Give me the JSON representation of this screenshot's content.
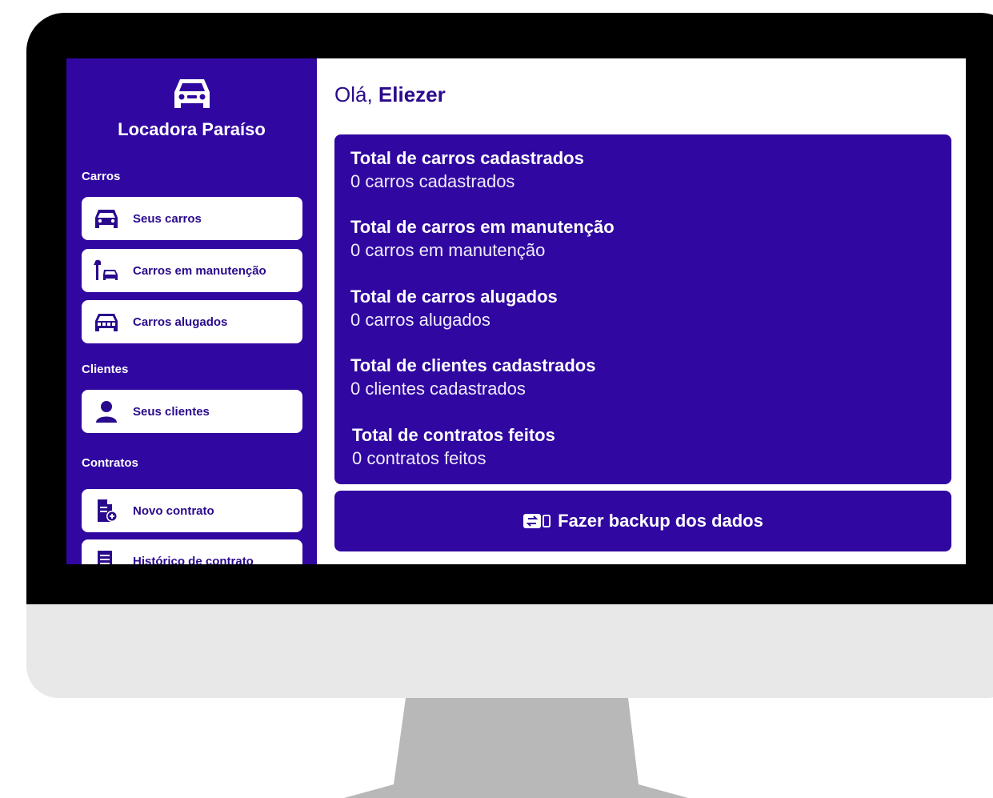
{
  "brand": {
    "name": "Locadora Paraíso",
    "icon": "car-front-icon"
  },
  "sidebar": {
    "sections": [
      {
        "label": "Carros",
        "items": [
          {
            "label": "Seus carros",
            "icon": "car-front-icon"
          },
          {
            "label": "Carros em manutenção",
            "icon": "wrench-car-icon"
          },
          {
            "label": "Carros alugados",
            "icon": "car-rented-icon"
          }
        ]
      },
      {
        "label": "Clientes",
        "items": [
          {
            "label": "Seus clientes",
            "icon": "user-icon"
          }
        ]
      },
      {
        "label": "Contratos",
        "items": [
          {
            "label": "Novo contrato",
            "icon": "file-add-icon"
          },
          {
            "label": "Histórico de contrato",
            "icon": "list-icon"
          }
        ]
      }
    ]
  },
  "main": {
    "greeting_prefix": "Olá, ",
    "user_name": "Eliezer",
    "stats": [
      {
        "title": "Total de carros cadastrados",
        "value": "0 carros cadastrados"
      },
      {
        "title": "Total de carros em manutenção",
        "value": "0 carros em manutenção"
      },
      {
        "title": "Total de carros alugados",
        "value": "0 carros alugados"
      },
      {
        "title": "Total de clientes cadastrados",
        "value": "0 clientes cadastrados"
      },
      {
        "title": "Total de contratos feitos",
        "value": "0 contratos feitos"
      }
    ],
    "backup_label": "Fazer backup dos dados",
    "backup_icon": "backup-icon"
  },
  "colors": {
    "primary": "#3007a0",
    "primary_text": "#2a0a8c",
    "bezel": "#000000",
    "chin": "#e8e8e8",
    "stand": "#b8b8b8"
  }
}
